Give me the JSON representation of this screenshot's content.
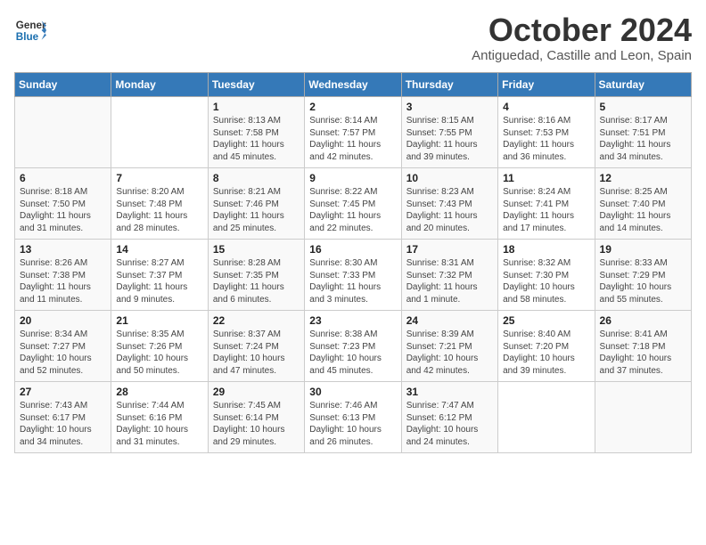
{
  "header": {
    "logo_line1": "General",
    "logo_line2": "Blue",
    "month": "October 2024",
    "location": "Antiguedad, Castille and Leon, Spain"
  },
  "columns": [
    "Sunday",
    "Monday",
    "Tuesday",
    "Wednesday",
    "Thursday",
    "Friday",
    "Saturday"
  ],
  "weeks": [
    [
      {
        "day": "",
        "info": ""
      },
      {
        "day": "",
        "info": ""
      },
      {
        "day": "1",
        "info": "Sunrise: 8:13 AM\nSunset: 7:58 PM\nDaylight: 11 hours and 45 minutes."
      },
      {
        "day": "2",
        "info": "Sunrise: 8:14 AM\nSunset: 7:57 PM\nDaylight: 11 hours and 42 minutes."
      },
      {
        "day": "3",
        "info": "Sunrise: 8:15 AM\nSunset: 7:55 PM\nDaylight: 11 hours and 39 minutes."
      },
      {
        "day": "4",
        "info": "Sunrise: 8:16 AM\nSunset: 7:53 PM\nDaylight: 11 hours and 36 minutes."
      },
      {
        "day": "5",
        "info": "Sunrise: 8:17 AM\nSunset: 7:51 PM\nDaylight: 11 hours and 34 minutes."
      }
    ],
    [
      {
        "day": "6",
        "info": "Sunrise: 8:18 AM\nSunset: 7:50 PM\nDaylight: 11 hours and 31 minutes."
      },
      {
        "day": "7",
        "info": "Sunrise: 8:20 AM\nSunset: 7:48 PM\nDaylight: 11 hours and 28 minutes."
      },
      {
        "day": "8",
        "info": "Sunrise: 8:21 AM\nSunset: 7:46 PM\nDaylight: 11 hours and 25 minutes."
      },
      {
        "day": "9",
        "info": "Sunrise: 8:22 AM\nSunset: 7:45 PM\nDaylight: 11 hours and 22 minutes."
      },
      {
        "day": "10",
        "info": "Sunrise: 8:23 AM\nSunset: 7:43 PM\nDaylight: 11 hours and 20 minutes."
      },
      {
        "day": "11",
        "info": "Sunrise: 8:24 AM\nSunset: 7:41 PM\nDaylight: 11 hours and 17 minutes."
      },
      {
        "day": "12",
        "info": "Sunrise: 8:25 AM\nSunset: 7:40 PM\nDaylight: 11 hours and 14 minutes."
      }
    ],
    [
      {
        "day": "13",
        "info": "Sunrise: 8:26 AM\nSunset: 7:38 PM\nDaylight: 11 hours and 11 minutes."
      },
      {
        "day": "14",
        "info": "Sunrise: 8:27 AM\nSunset: 7:37 PM\nDaylight: 11 hours and 9 minutes."
      },
      {
        "day": "15",
        "info": "Sunrise: 8:28 AM\nSunset: 7:35 PM\nDaylight: 11 hours and 6 minutes."
      },
      {
        "day": "16",
        "info": "Sunrise: 8:30 AM\nSunset: 7:33 PM\nDaylight: 11 hours and 3 minutes."
      },
      {
        "day": "17",
        "info": "Sunrise: 8:31 AM\nSunset: 7:32 PM\nDaylight: 11 hours and 1 minute."
      },
      {
        "day": "18",
        "info": "Sunrise: 8:32 AM\nSunset: 7:30 PM\nDaylight: 10 hours and 58 minutes."
      },
      {
        "day": "19",
        "info": "Sunrise: 8:33 AM\nSunset: 7:29 PM\nDaylight: 10 hours and 55 minutes."
      }
    ],
    [
      {
        "day": "20",
        "info": "Sunrise: 8:34 AM\nSunset: 7:27 PM\nDaylight: 10 hours and 52 minutes."
      },
      {
        "day": "21",
        "info": "Sunrise: 8:35 AM\nSunset: 7:26 PM\nDaylight: 10 hours and 50 minutes."
      },
      {
        "day": "22",
        "info": "Sunrise: 8:37 AM\nSunset: 7:24 PM\nDaylight: 10 hours and 47 minutes."
      },
      {
        "day": "23",
        "info": "Sunrise: 8:38 AM\nSunset: 7:23 PM\nDaylight: 10 hours and 45 minutes."
      },
      {
        "day": "24",
        "info": "Sunrise: 8:39 AM\nSunset: 7:21 PM\nDaylight: 10 hours and 42 minutes."
      },
      {
        "day": "25",
        "info": "Sunrise: 8:40 AM\nSunset: 7:20 PM\nDaylight: 10 hours and 39 minutes."
      },
      {
        "day": "26",
        "info": "Sunrise: 8:41 AM\nSunset: 7:18 PM\nDaylight: 10 hours and 37 minutes."
      }
    ],
    [
      {
        "day": "27",
        "info": "Sunrise: 7:43 AM\nSunset: 6:17 PM\nDaylight: 10 hours and 34 minutes."
      },
      {
        "day": "28",
        "info": "Sunrise: 7:44 AM\nSunset: 6:16 PM\nDaylight: 10 hours and 31 minutes."
      },
      {
        "day": "29",
        "info": "Sunrise: 7:45 AM\nSunset: 6:14 PM\nDaylight: 10 hours and 29 minutes."
      },
      {
        "day": "30",
        "info": "Sunrise: 7:46 AM\nSunset: 6:13 PM\nDaylight: 10 hours and 26 minutes."
      },
      {
        "day": "31",
        "info": "Sunrise: 7:47 AM\nSunset: 6:12 PM\nDaylight: 10 hours and 24 minutes."
      },
      {
        "day": "",
        "info": ""
      },
      {
        "day": "",
        "info": ""
      }
    ]
  ]
}
